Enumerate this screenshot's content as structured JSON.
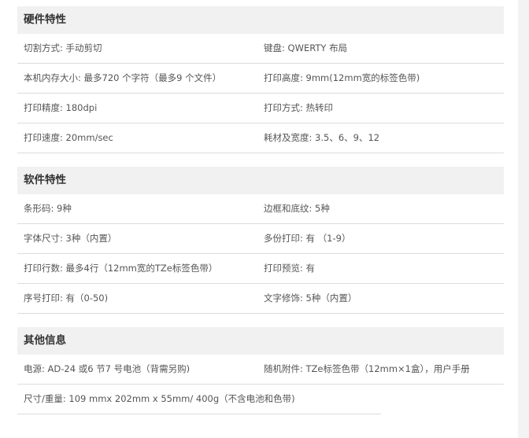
{
  "sections": [
    {
      "title": "硬件特性",
      "rows": [
        [
          "切割方式: 手动剪切",
          "键盘: QWERTY 布局"
        ],
        [
          "本机内存大小: 最多720 个字符（最多9 个文件）",
          "打印高度: 9mm(12mm宽的标签色带)"
        ],
        [
          "打印精度: 180dpi",
          "打印方式: 热转印"
        ],
        [
          "打印速度: 20mm/sec",
          "耗材及宽度: 3.5、6、9、12"
        ]
      ]
    },
    {
      "title": "软件特性",
      "rows": [
        [
          "条形码: 9种",
          "边框和底纹: 5种"
        ],
        [
          "字体尺寸: 3种（内置）",
          "多份打印: 有 （1-9）"
        ],
        [
          "打印行数: 最多4行（12mm宽的TZe标签色带）",
          "打印预览: 有"
        ],
        [
          "序号打印: 有（0-50)",
          "文字修饰: 5种（内置）"
        ]
      ]
    },
    {
      "title": "其他信息",
      "rows": [
        [
          "电源: AD-24 或6 节7 号电池（背需另购)",
          "随机附件: TZe标签色带（12mm×1盒），用户手册"
        ]
      ],
      "last": "尺寸/重量: 109 mmx 202mm x 55mm/ 400g（不含电池和色带)"
    }
  ]
}
